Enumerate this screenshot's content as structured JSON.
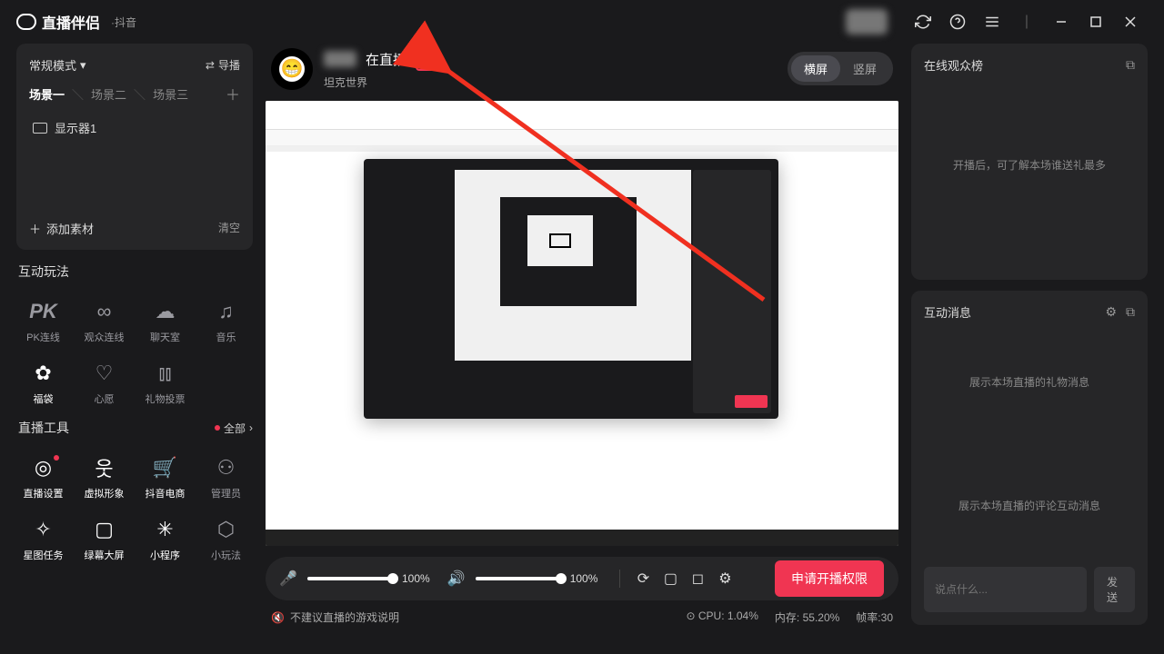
{
  "app": {
    "name": "直播伴侣",
    "sub": "·抖音"
  },
  "titlebar_user_blurred": true,
  "left": {
    "mode": "常规模式",
    "guide": "导播",
    "scenes": [
      "场景一",
      "场景二",
      "场景三"
    ],
    "active_scene": 0,
    "sources": [
      {
        "label": "显示器1",
        "icon": "monitor"
      }
    ],
    "add_source": "添加素材",
    "clear": "清空"
  },
  "interactive": {
    "title": "互动玩法",
    "items": [
      {
        "label": "PK连线",
        "icon": "PK"
      },
      {
        "label": "观众连线",
        "icon": "link"
      },
      {
        "label": "聊天室",
        "icon": "chat"
      },
      {
        "label": "音乐",
        "icon": "music"
      },
      {
        "label": "福袋",
        "icon": "bag",
        "active": true
      },
      {
        "label": "心愿",
        "icon": "heart"
      },
      {
        "label": "礼物投票",
        "icon": "vote"
      }
    ]
  },
  "tools": {
    "title": "直播工具",
    "all": "全部",
    "items": [
      {
        "label": "直播设置",
        "icon": "gear",
        "red": true
      },
      {
        "label": "虚拟形象",
        "icon": "avatar"
      },
      {
        "label": "抖音电商",
        "icon": "cart"
      },
      {
        "label": "管理员",
        "icon": "admin"
      },
      {
        "label": "星图任务",
        "icon": "star"
      },
      {
        "label": "绿幕大屏",
        "icon": "screen"
      },
      {
        "label": "小程序",
        "icon": "app"
      },
      {
        "label": "小玩法",
        "icon": "play"
      }
    ]
  },
  "stream": {
    "title_suffix": "在直播",
    "category": "坦克世界",
    "orientation": {
      "horizontal": "横屏",
      "vertical": "竖屏",
      "active": "horizontal"
    }
  },
  "controls": {
    "mic_pct": "100%",
    "spk_pct": "100%",
    "go_live": "申请开播权限"
  },
  "status": {
    "warning": "不建议直播的游戏说明",
    "cpu_label": "CPU:",
    "cpu_val": "1.04%",
    "mem_label": "内存:",
    "mem_val": "55.20%",
    "fps_label": "帧率:",
    "fps_val": "30"
  },
  "right": {
    "viewers_title": "在线观众榜",
    "viewers_empty": "开播后，可了解本场谁送礼最多",
    "msg_title": "互动消息",
    "gift_empty": "展示本场直播的礼物消息",
    "comment_empty": "展示本场直播的评论互动消息",
    "chat_placeholder": "说点什么...",
    "send": "发送"
  },
  "colors": {
    "accent": "#f03552"
  }
}
